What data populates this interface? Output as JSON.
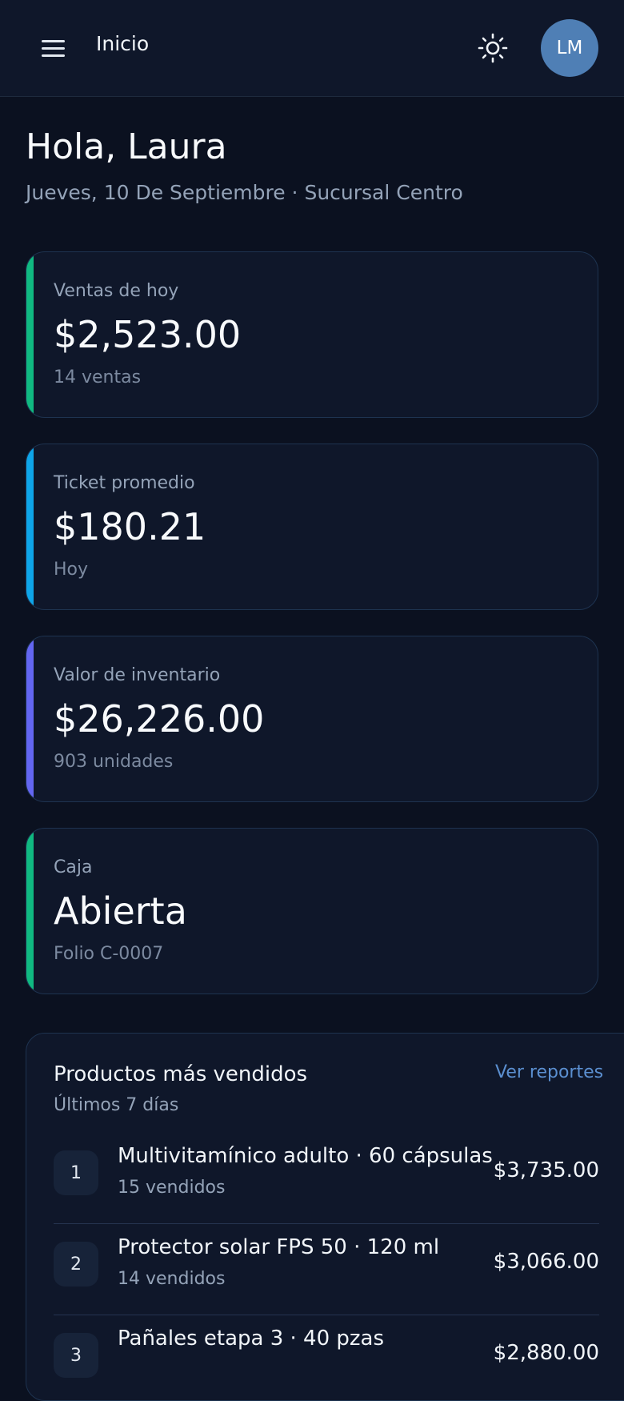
{
  "header": {
    "title": "Inicio",
    "theme_icon": "sun-icon",
    "menu_icon": "hamburger-menu-icon",
    "avatar_initials": "LM"
  },
  "greeting": {
    "title": "Hola, Laura",
    "subtitle": "Jueves, 10 De Septiembre · Sucursal Centro"
  },
  "stats": [
    {
      "label": "Ventas de hoy",
      "value": "$2,523.00",
      "sub": "14 ventas",
      "accent": "#10b981"
    },
    {
      "label": "Ticket promedio",
      "value": "$180.21",
      "sub": "Hoy",
      "accent": "#0ea5e9"
    },
    {
      "label": "Valor de inventario",
      "value": "$26,226.00",
      "sub": "903 unidades",
      "accent": "#6366f1"
    },
    {
      "label": "Caja",
      "value": "Abierta",
      "sub": "Folio C-0007",
      "accent": "#10b981"
    }
  ],
  "top_products": {
    "title": "Productos más vendidos",
    "subtitle": "Últimos 7 días",
    "link": "Ver reportes",
    "items": [
      {
        "rank": "1",
        "name": "Multivitamínico adulto · 60 cápsulas",
        "sold": "15 vendidos",
        "amount": "$3,735.00"
      },
      {
        "rank": "2",
        "name": "Protector solar FPS 50 · 120 ml",
        "sold": "14 vendidos",
        "amount": "$3,066.00"
      },
      {
        "rank": "3",
        "name": "Pañales etapa 3 · 40 pzas",
        "sold": "",
        "amount": "$2,880.00"
      }
    ]
  },
  "colors": {
    "background": "#0b1120",
    "card": "#0f172a",
    "avatar": "#4f7fb5",
    "link": "#5b8fd0"
  }
}
